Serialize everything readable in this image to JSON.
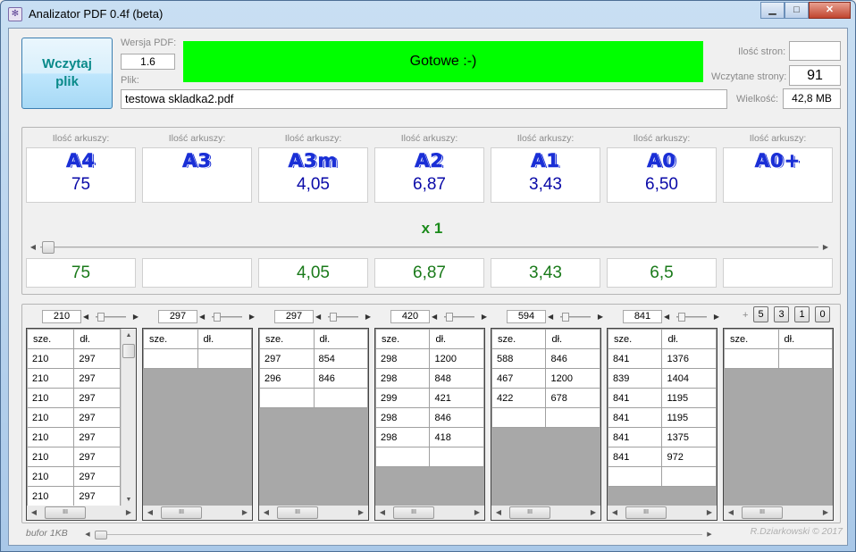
{
  "window": {
    "title": "Analizator PDF 0.4f (beta)",
    "icon": "app-icon",
    "minimize": "▁",
    "maximize": "□",
    "close": "✕"
  },
  "top": {
    "load_button": "Wczytaj plik",
    "version_label": "Wersja PDF:",
    "version_value": "1.6",
    "status": "Gotowe   :-)",
    "status_color": "#00ff00",
    "file_label": "Plik:",
    "file_value": "testowa skladka2.pdf",
    "pages_label": "Ilość stron:",
    "pages_value": "",
    "loaded_label": "Wczytane strony:",
    "loaded_value": "91",
    "size_label": "Wielkość:",
    "size_value": "42,8 MB"
  },
  "formats": [
    {
      "label": "Ilość arkuszy:",
      "name": "A4",
      "value": "75",
      "result": "75"
    },
    {
      "label": "Ilość arkuszy:",
      "name": "A3",
      "value": "",
      "result": ""
    },
    {
      "label": "Ilość arkuszy:",
      "name": "A3m",
      "value": "4,05",
      "result": "4,05"
    },
    {
      "label": "Ilość arkuszy:",
      "name": "A2",
      "value": "6,87",
      "result": "6,87"
    },
    {
      "label": "Ilość arkuszy:",
      "name": "A1",
      "value": "3,43",
      "result": "3,43"
    },
    {
      "label": "Ilość arkuszy:",
      "name": "A0",
      "value": "6,50",
      "result": "6,5"
    },
    {
      "label": "Ilość arkuszy:",
      "name": "A0+",
      "value": "",
      "result": ""
    }
  ],
  "multiplier": "x 1",
  "columns": [
    {
      "width": "210",
      "headers": [
        "sze.",
        "dł."
      ],
      "rows": [
        [
          "210",
          "297"
        ],
        [
          "210",
          "297"
        ],
        [
          "210",
          "297"
        ],
        [
          "210",
          "297"
        ],
        [
          "210",
          "297"
        ],
        [
          "210",
          "297"
        ],
        [
          "210",
          "297"
        ],
        [
          "210",
          "297"
        ]
      ],
      "vscroll": true
    },
    {
      "width": "297",
      "headers": [
        "sze.",
        "dł."
      ],
      "rows": [
        [
          "",
          ""
        ]
      ]
    },
    {
      "width": "297",
      "headers": [
        "sze.",
        "dł."
      ],
      "rows": [
        [
          "297",
          "854"
        ],
        [
          "296",
          "846"
        ],
        [
          "",
          ""
        ]
      ]
    },
    {
      "width": "420",
      "headers": [
        "sze.",
        "dł."
      ],
      "rows": [
        [
          "298",
          "1200"
        ],
        [
          "298",
          "848"
        ],
        [
          "299",
          "421"
        ],
        [
          "298",
          "846"
        ],
        [
          "298",
          "418"
        ],
        [
          "",
          ""
        ]
      ]
    },
    {
      "width": "594",
      "headers": [
        "sze.",
        "dł."
      ],
      "rows": [
        [
          "588",
          "846"
        ],
        [
          "467",
          "1200"
        ],
        [
          "422",
          "678"
        ],
        [
          "",
          ""
        ]
      ]
    },
    {
      "width": "841",
      "headers": [
        "sze.",
        "dł."
      ],
      "rows": [
        [
          "841",
          "1376"
        ],
        [
          "839",
          "1404"
        ],
        [
          "841",
          "1195"
        ],
        [
          "841",
          "1195"
        ],
        [
          "841",
          "1375"
        ],
        [
          "841",
          "972"
        ],
        [
          "",
          ""
        ]
      ]
    },
    {
      "width": "",
      "headers": [
        "sze.",
        "dł."
      ],
      "rows": [
        [
          "",
          ""
        ]
      ]
    }
  ],
  "plus": "+",
  "quick_buttons": [
    "5",
    "3",
    "1",
    "0"
  ],
  "footer": {
    "buffer": "bufor 1KB",
    "author": "R.Dziarkowski © 2017"
  }
}
